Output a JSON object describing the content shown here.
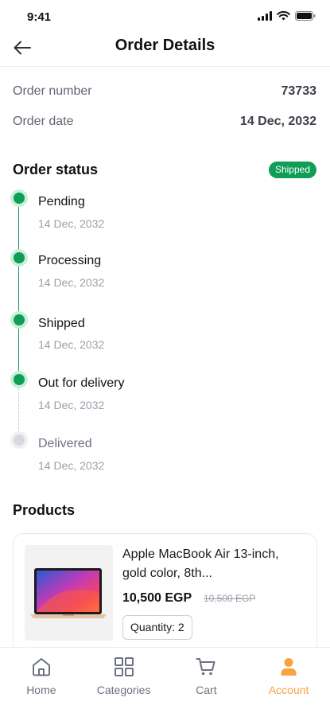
{
  "status_bar": {
    "time": "9:41"
  },
  "header": {
    "title": "Order Details"
  },
  "order": {
    "number_label": "Order number",
    "number_value": "73733",
    "date_label": "Order date",
    "date_value": "14 Dec, 2032"
  },
  "order_status": {
    "title": "Order status",
    "badge": "Shipped",
    "steps": [
      {
        "label": "Pending",
        "date": "14 Dec, 2032",
        "done": true
      },
      {
        "label": "Processing",
        "date": "14 Dec, 2032",
        "done": true
      },
      {
        "label": "Shipped",
        "date": "14 Dec, 2032",
        "done": true
      },
      {
        "label": "Out for delivery",
        "date": "14 Dec, 2032",
        "done": true
      },
      {
        "label": "Delivered",
        "date": "14 Dec, 2032",
        "done": false
      }
    ]
  },
  "products": {
    "title": "Products",
    "items": [
      {
        "name": "Apple MacBook Air 13-inch, gold color, 8th...",
        "price": "10,500 EGP",
        "old_price": "10,500 EGP",
        "quantity": "Quantity: 2"
      }
    ]
  },
  "tabbar": {
    "items": [
      {
        "label": "Home",
        "icon": "home-icon",
        "active": false
      },
      {
        "label": "Categories",
        "icon": "categories-icon",
        "active": false
      },
      {
        "label": "Cart",
        "icon": "cart-icon",
        "active": false
      },
      {
        "label": "Account",
        "icon": "account-icon",
        "active": true
      }
    ]
  },
  "colors": {
    "accent_green": "#0f9d58",
    "active_orange": "#f7a440",
    "muted_gray": "#d7d9de"
  }
}
